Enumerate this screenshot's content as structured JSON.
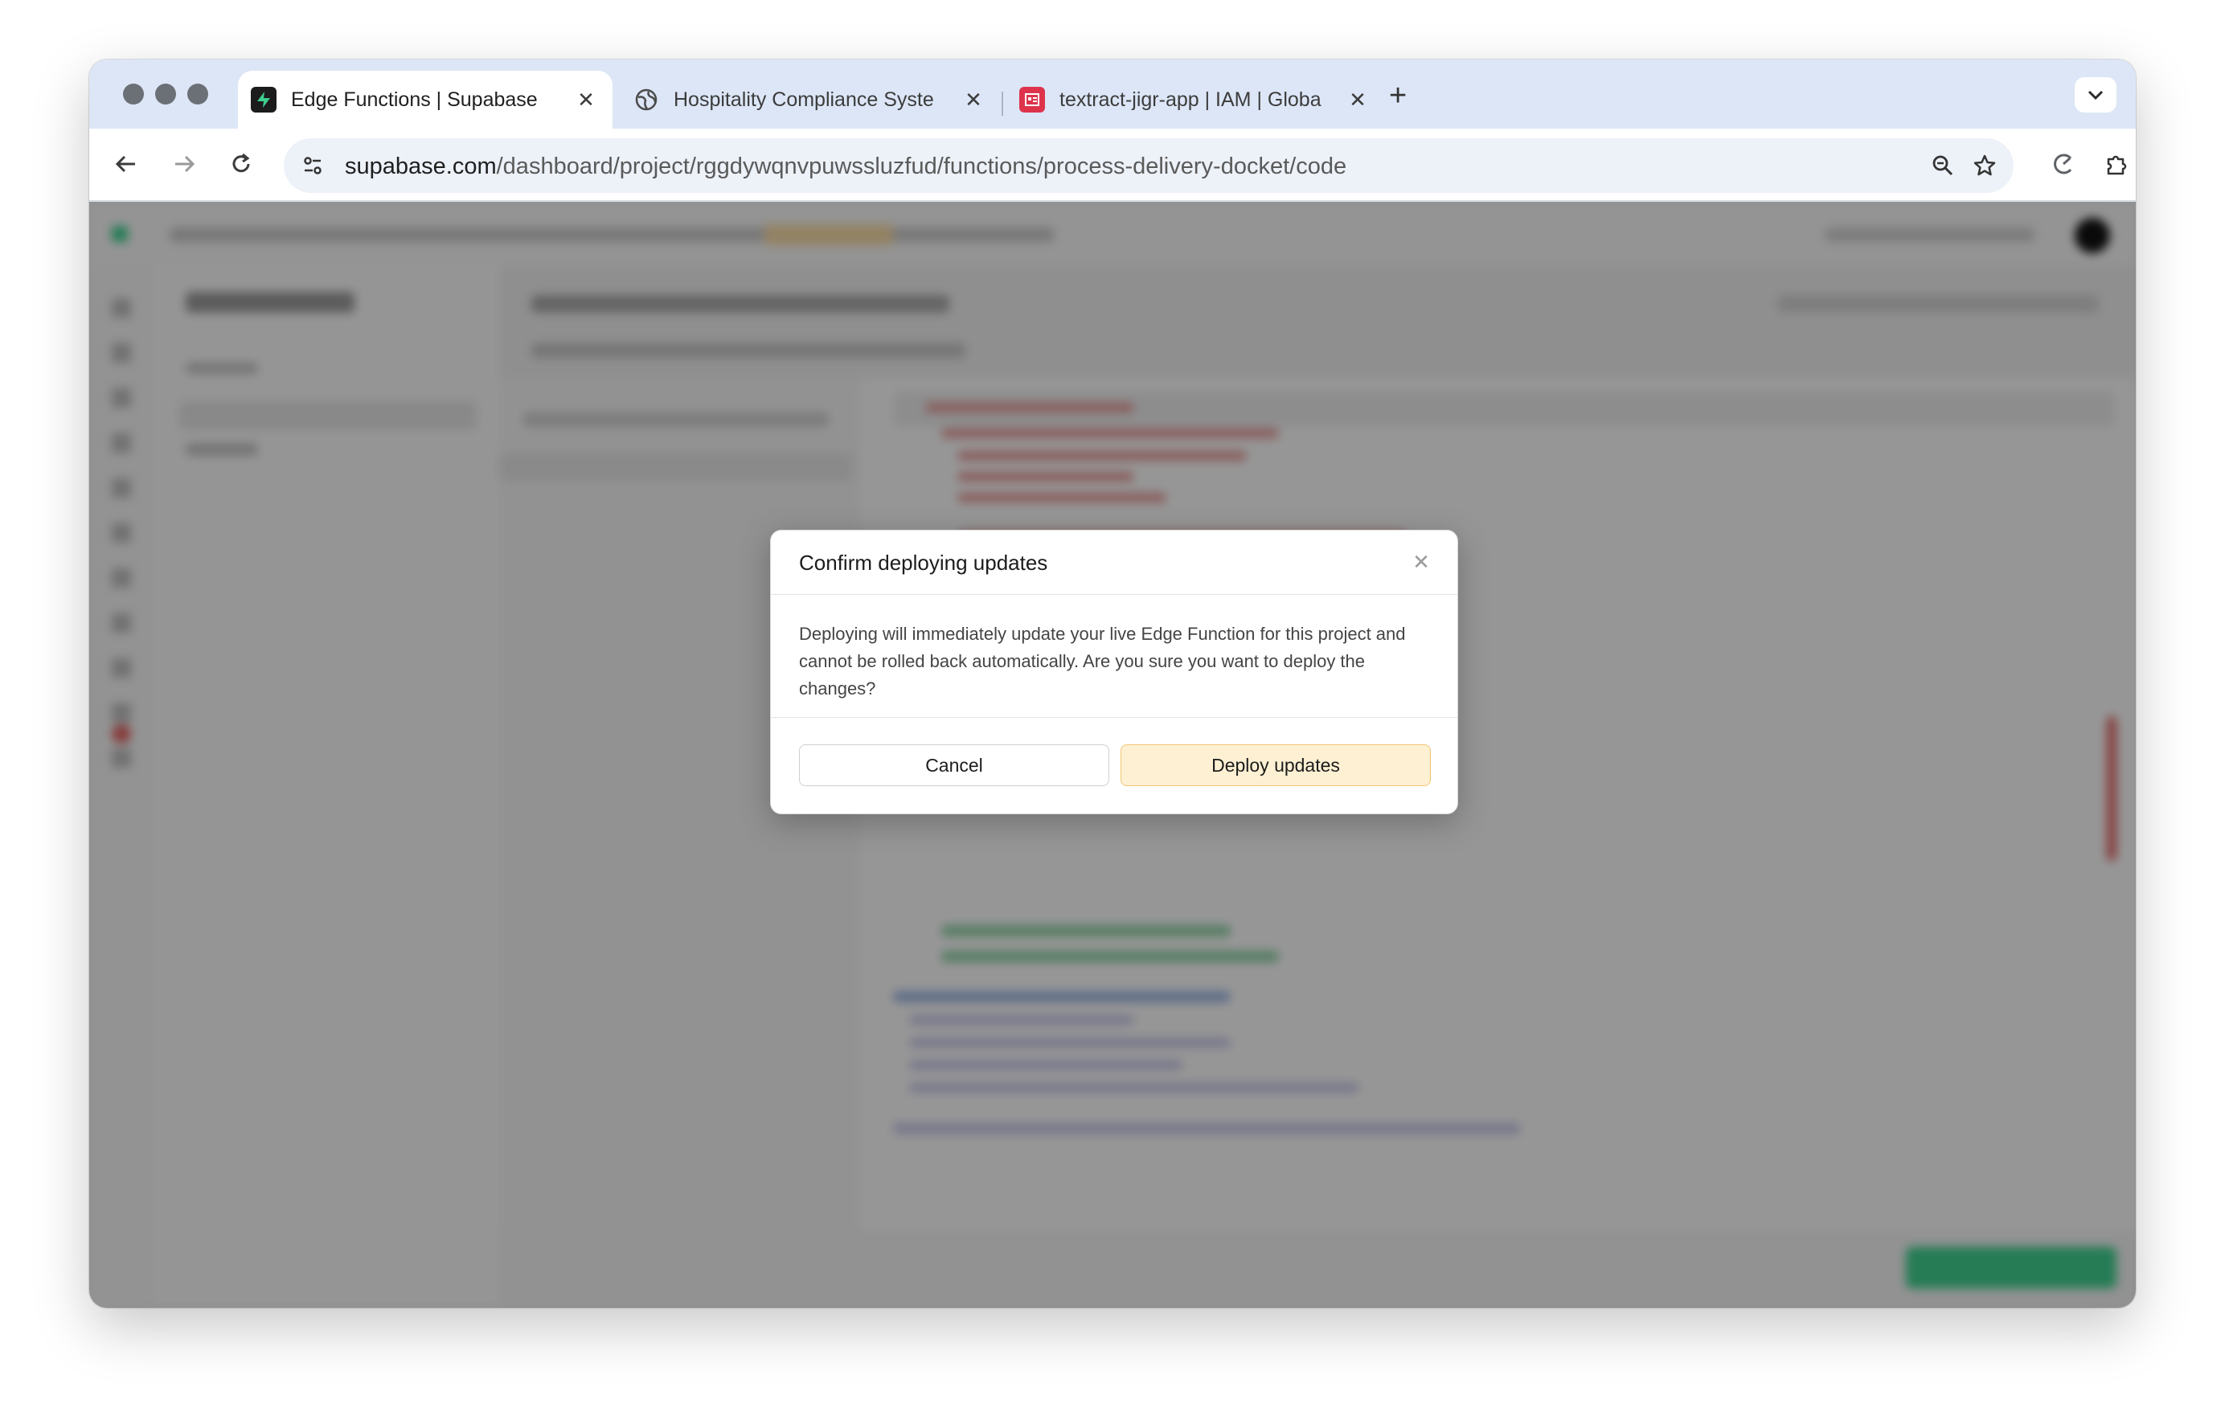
{
  "browser": {
    "tabs": [
      {
        "title": "Edge Functions | Supabase",
        "active": true,
        "favicon": "supabase-logo"
      },
      {
        "title": "Hospitality Compliance Syste",
        "active": false,
        "favicon": "globe-icon"
      },
      {
        "title": "textract-jigr-app | IAM | Globa",
        "active": false,
        "favicon": "aws-iam-icon"
      }
    ],
    "new_tab_label": "+",
    "url": {
      "host": "supabase.com",
      "path": "/dashboard/project/rggdywqnvpuwssluzfud/functions/process-delivery-docket/code"
    }
  },
  "dialog": {
    "title": "Confirm deploying updates",
    "message": "Deploying will immediately update your live Edge Function for this project and cannot be rolled back automatically. Are you sure you want to deploy the changes?",
    "cancel_label": "Cancel",
    "confirm_label": "Deploy updates"
  },
  "colors": {
    "supabase_green": "#3ecf8e",
    "confirm_button_bg": "#fdf0d3",
    "confirm_button_border": "#f2c470",
    "overlay": "rgba(0,0,0,0.40)"
  }
}
